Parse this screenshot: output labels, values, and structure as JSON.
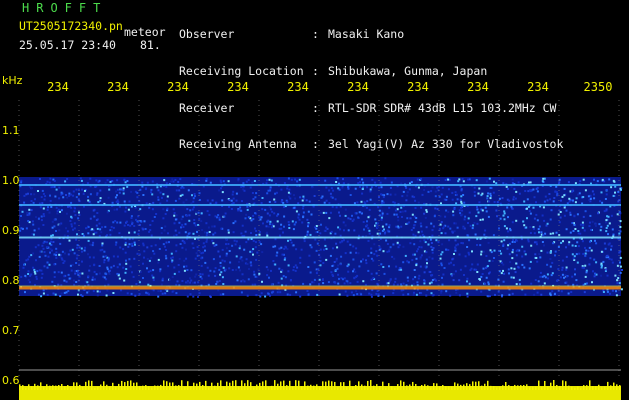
{
  "header": {
    "logo": "HROFFT",
    "filename": "UT2505172340.pn",
    "tag": "meteor",
    "datetime": "25.05.17 23:40",
    "count": "81.",
    "meta": [
      {
        "label": "Observer",
        "value": "Masaki Kano"
      },
      {
        "label": "Receiving Location",
        "value": "Shibukawa, Gunma, Japan"
      },
      {
        "label": "Receiver",
        "value": "RTL-SDR SDR# 43dB L15 103.2MHz CW"
      },
      {
        "label": "Receiving Antenna",
        "value": "3el Yagi(V) Az 330 for Vladivostok"
      }
    ],
    "separator": ":"
  },
  "colors": {
    "text_green": "#4cdc4c",
    "text_yellow": "#f0f000",
    "text_white": "#f0f0f0",
    "background": "#000000",
    "waterfall_low": "#0a1a8c",
    "waterfall_high": "#ffffff",
    "meteor_line": "#ff8a00"
  },
  "chart_data": {
    "type": "heatmap",
    "ylabel": "kHz",
    "xlabel": "",
    "x_ticks": [
      "234",
      "234",
      "234",
      "234",
      "234",
      "234",
      "234",
      "234",
      "234",
      "2350"
    ],
    "y_ticks": [
      "1.1",
      "1.0",
      "0.9",
      "0.8",
      "0.7",
      "0.6"
    ],
    "y_values": [
      1.1,
      1.0,
      0.9,
      0.8,
      0.7,
      0.6
    ],
    "ylim": [
      0.6,
      1.1
    ],
    "noise_band": [
      0.78,
      1.0
    ],
    "lines": [
      {
        "freq": 0.99,
        "strength": 0.55
      },
      {
        "freq": 0.95,
        "strength": 0.4
      },
      {
        "freq": 0.885,
        "strength": 0.7
      },
      {
        "freq": 0.785,
        "strength": 1.0
      }
    ],
    "grid": true
  }
}
